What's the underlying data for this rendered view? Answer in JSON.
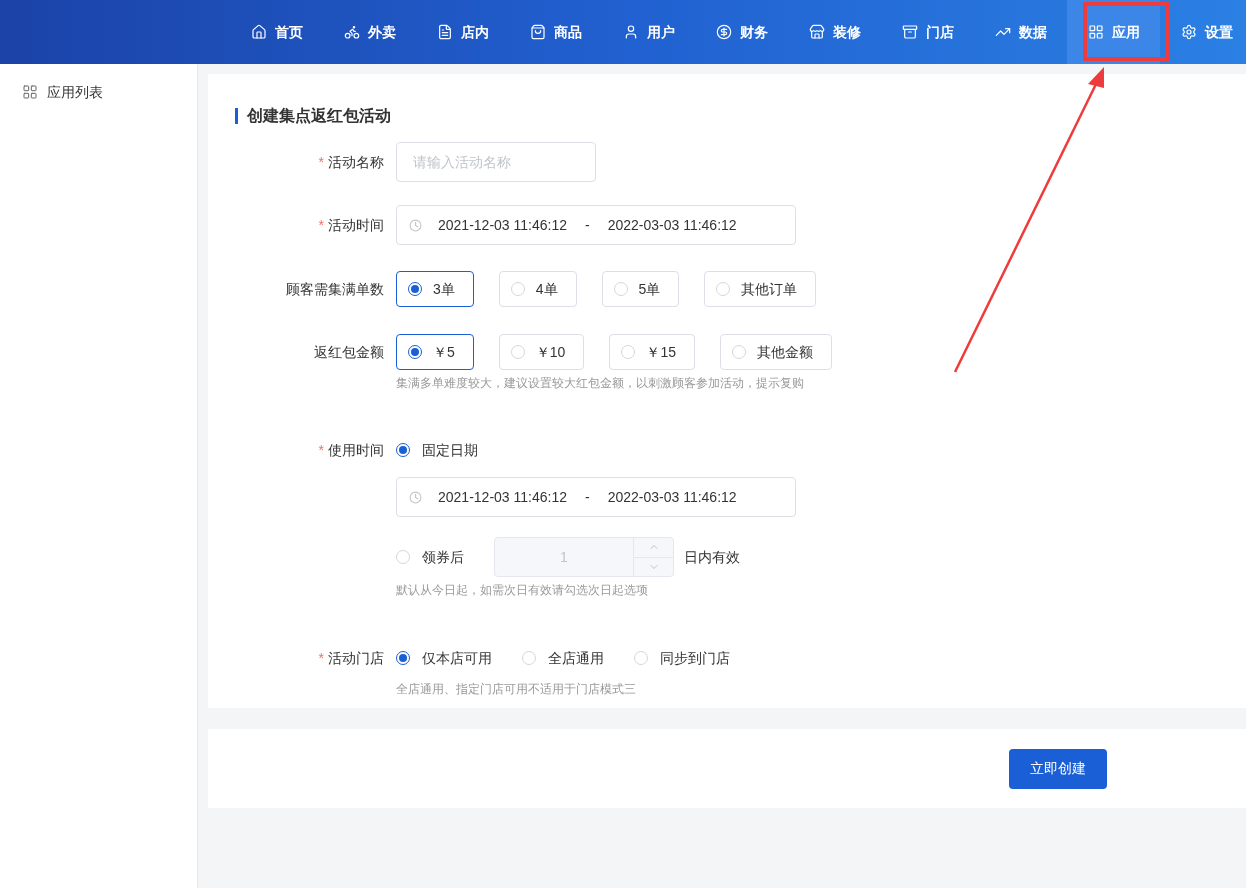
{
  "nav": [
    {
      "label": "首页",
      "selected": false
    },
    {
      "label": "外卖",
      "selected": false
    },
    {
      "label": "店内",
      "selected": false
    },
    {
      "label": "商品",
      "selected": false
    },
    {
      "label": "用户",
      "selected": false
    },
    {
      "label": "财务",
      "selected": false
    },
    {
      "label": "装修",
      "selected": false
    },
    {
      "label": "门店",
      "selected": false
    },
    {
      "label": "数据",
      "selected": false
    },
    {
      "label": "应用",
      "selected": true
    },
    {
      "label": "设置",
      "selected": false
    }
  ],
  "sidebar": {
    "items": [
      {
        "label": "应用列表"
      }
    ]
  },
  "form": {
    "title": "创建集点返红包活动",
    "fields": [
      {
        "kind": "text",
        "label": "活动名称",
        "required_mark": "*",
        "placeholder": "请输入活动名称"
      },
      {
        "kind": "daterange",
        "label": "活动时间",
        "required_mark": "*",
        "start": "2021-12-03 11:46:12",
        "separator": "-",
        "end": "2022-03-03 11:46:12"
      },
      {
        "kind": "radiocards",
        "label": "顾客需集满单数",
        "options": [
          {
            "label": "3单",
            "selected": true
          },
          {
            "label": "4单",
            "selected": false
          },
          {
            "label": "5单",
            "selected": false
          },
          {
            "label": "其他订单",
            "selected": false
          }
        ]
      },
      {
        "kind": "radiocards",
        "label": "返红包金额",
        "options": [
          {
            "label": "￥5",
            "selected": true
          },
          {
            "label": "￥10",
            "selected": false
          },
          {
            "label": "￥15",
            "selected": false
          },
          {
            "label": "其他金额",
            "selected": false
          }
        ],
        "hint": "集满多单难度较大，建议设置较大红包金额，以刺激顾客参加活动，提示复购"
      },
      {
        "kind": "usage",
        "label": "使用时间",
        "required_mark": "*",
        "fixed": {
          "label": "固定日期",
          "selected": true,
          "start": "2021-12-03 11:46:12",
          "separator": "-",
          "end": "2022-03-03 11:46:12"
        },
        "after": {
          "label": "领券后",
          "selected": false,
          "value": "1",
          "suffix": "日内有效",
          "disabled": true
        },
        "hint": "默认从今日起，如需次日有效请勾选次日起选项"
      },
      {
        "kind": "radios",
        "label": "活动门店",
        "required_mark": "*",
        "options": [
          {
            "label": "仅本店可用",
            "selected": true
          },
          {
            "label": "全店通用",
            "selected": false
          },
          {
            "label": "同步到门店",
            "selected": false
          }
        ],
        "hint": "全店通用、指定门店可用不适用于门店模式三"
      }
    ]
  },
  "submit": {
    "label": "立即创建"
  }
}
